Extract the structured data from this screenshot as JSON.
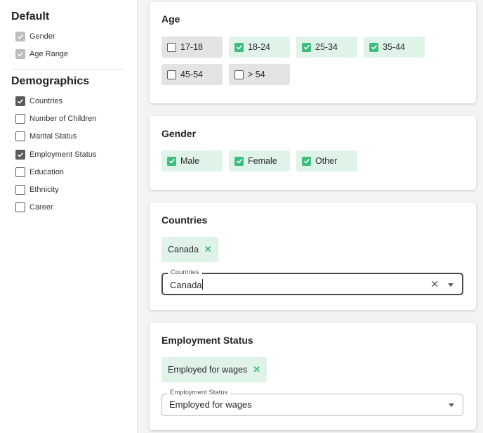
{
  "sidebar": {
    "default_heading": "Default",
    "default_items": [
      {
        "label": "Gender",
        "state": "disabled-checked"
      },
      {
        "label": "Age Range",
        "state": "disabled-checked"
      }
    ],
    "demographics_heading": "Demographics",
    "demographics_items": [
      {
        "label": "Countries",
        "state": "checked"
      },
      {
        "label": "Number of Children",
        "state": "unchecked"
      },
      {
        "label": "Marital Status",
        "state": "unchecked"
      },
      {
        "label": "Employment Status",
        "state": "checked"
      },
      {
        "label": "Education",
        "state": "unchecked"
      },
      {
        "label": "Ethnicity",
        "state": "unchecked"
      },
      {
        "label": "Career",
        "state": "unchecked"
      }
    ]
  },
  "age": {
    "title": "Age",
    "options": [
      {
        "label": "17-18",
        "checked": false
      },
      {
        "label": "18-24",
        "checked": true
      },
      {
        "label": "25-34",
        "checked": true
      },
      {
        "label": "35-44",
        "checked": true
      },
      {
        "label": "45-54",
        "checked": false
      },
      {
        "label": "> 54",
        "checked": false
      }
    ]
  },
  "gender": {
    "title": "Gender",
    "options": [
      {
        "label": "Male",
        "checked": true
      },
      {
        "label": "Female",
        "checked": true
      },
      {
        "label": "Other",
        "checked": true
      }
    ]
  },
  "countries": {
    "title": "Countries",
    "chip": "Canada",
    "field_label": "Countries",
    "field_value": "Canada"
  },
  "employment": {
    "title": "Employment Status",
    "chip": "Employed for wages",
    "field_label": "Employment Status",
    "field_value": "Employed for wages"
  },
  "colors": {
    "accent_green": "#3dbd7d",
    "chip_bg": "#dff3e8"
  }
}
